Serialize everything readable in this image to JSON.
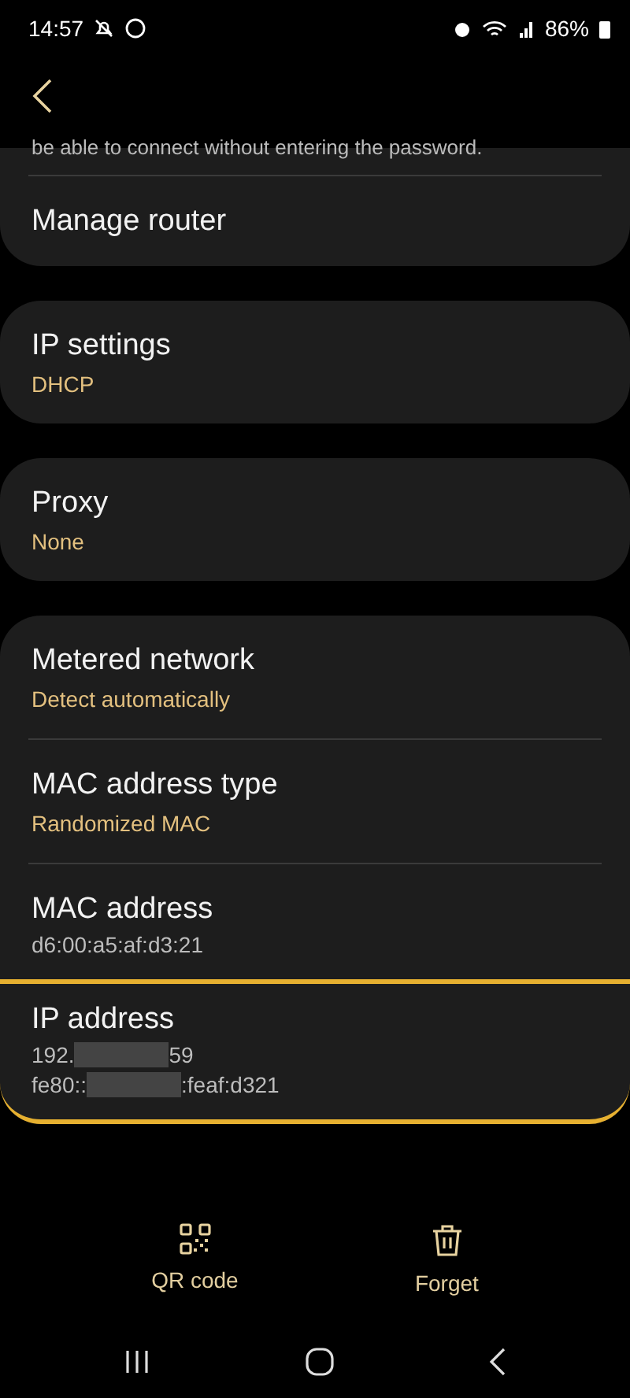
{
  "status_bar": {
    "time": "14:57",
    "battery": "86%"
  },
  "groups": [
    {
      "items": [
        {
          "kind": "note",
          "title": "be able to connect without entering the password."
        },
        {
          "kind": "plain",
          "title": "Manage router"
        }
      ]
    },
    {
      "items": [
        {
          "kind": "value",
          "title": "IP settings",
          "value": "DHCP"
        }
      ]
    },
    {
      "items": [
        {
          "kind": "value",
          "title": "Proxy",
          "value": "None"
        }
      ]
    },
    {
      "items": [
        {
          "kind": "value",
          "title": "Metered network",
          "value": "Detect automatically"
        },
        {
          "kind": "value",
          "title": "MAC address type",
          "value": "Randomized MAC"
        },
        {
          "kind": "info",
          "title": "MAC address",
          "lines": [
            {
              "before": "d6:00:a5:af:d3:21",
              "redacted": false
            }
          ]
        },
        {
          "kind": "info",
          "title": "IP address",
          "highlighted": true,
          "lines": [
            {
              "before": "192.",
              "redacted": true,
              "after": "59"
            },
            {
              "before": "fe80::",
              "redacted": true,
              "after": ":feaf:d321"
            }
          ]
        }
      ]
    }
  ],
  "actions": [
    {
      "kind": "qr",
      "label": "QR code"
    },
    {
      "kind": "trash",
      "label": "Forget"
    }
  ]
}
